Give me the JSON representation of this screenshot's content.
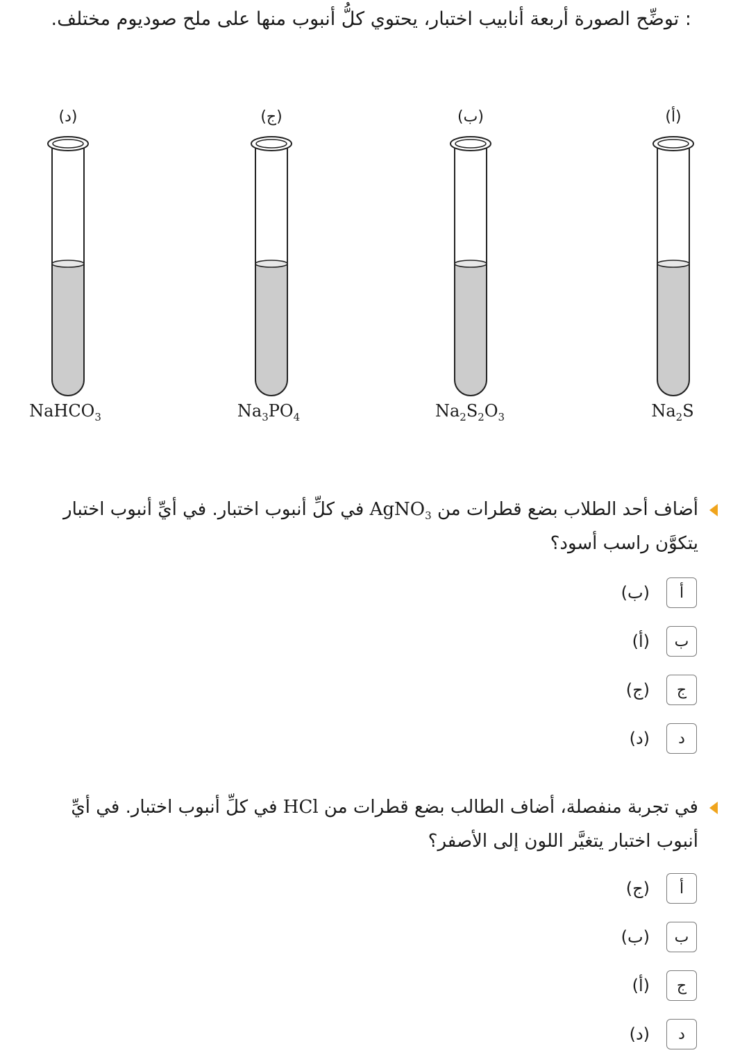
{
  "intro": ": توضِّح الصورة أربعة أنابيب اختبار، يحتوي كلُّ أنبوب منها على ملح صوديوم مختلف.",
  "tubes": [
    {
      "label": "(أ)",
      "formula_parts": [
        "Na",
        "2",
        "S"
      ]
    },
    {
      "label": "(ب)",
      "formula_parts": [
        "Na",
        "2",
        "S",
        "2",
        "O",
        "3"
      ]
    },
    {
      "label": "(ج)",
      "formula_parts": [
        "Na",
        "3",
        "PO",
        "4"
      ]
    },
    {
      "label": "(د)",
      "formula_parts": [
        "NaHCO",
        "3"
      ]
    }
  ],
  "colors": {
    "liquid": "#cccccc",
    "marker": "#f0a41c",
    "box_border": "#7a7a7a"
  },
  "questions": [
    {
      "text_before": "أضاف أحد الطلاب بضع قطرات من ",
      "chem_main": "AgNO",
      "chem_sub": "3",
      "text_after": " في كلِّ أنبوب اختبار. في أيِّ أنبوب اختبار يتكوَّن راسب أسود؟",
      "options": [
        {
          "letter": "أ",
          "text": "(ب)"
        },
        {
          "letter": "ب",
          "text": "(أ)"
        },
        {
          "letter": "ج",
          "text": "(ج)"
        },
        {
          "letter": "د",
          "text": "(د)"
        }
      ]
    },
    {
      "text_before": "في تجربة منفصلة، أضاف الطالب بضع قطرات من ",
      "chem_main": "HCl",
      "chem_sub": "",
      "text_after": " في كلِّ أنبوب اختبار. في أيِّ أنبوب اختبار يتغيَّر اللون إلى الأصفر؟",
      "options": [
        {
          "letter": "أ",
          "text": "(ج)"
        },
        {
          "letter": "ب",
          "text": "(ب)"
        },
        {
          "letter": "ج",
          "text": "(أ)"
        },
        {
          "letter": "د",
          "text": "(د)"
        }
      ]
    }
  ]
}
